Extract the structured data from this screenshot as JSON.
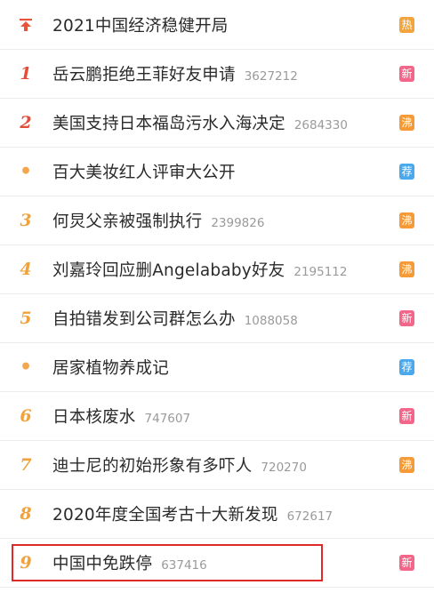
{
  "badge_colors": {
    "热": "#f2a43d",
    "新": "#f3668a",
    "沸": "#f59a36",
    "荐": "#4aa8ed"
  },
  "items": [
    {
      "rank": "",
      "rank_style": "pin",
      "title": "2021中国经济稳健开局",
      "count": "",
      "badge": "热"
    },
    {
      "rank": "1",
      "rank_style": "r1",
      "title": "岳云鹏拒绝王菲好友申请",
      "count": "3627212",
      "badge": "新"
    },
    {
      "rank": "2",
      "rank_style": "r2",
      "title": "美国支持日本福岛污水入海决定",
      "count": "2684330",
      "badge": "沸"
    },
    {
      "rank": "•",
      "rank_style": "dot",
      "title": "百大美妆红人评审大公开",
      "count": "",
      "badge": "荐"
    },
    {
      "rank": "3",
      "rank_style": "rn",
      "title": "何炅父亲被强制执行",
      "count": "2399826",
      "badge": "沸"
    },
    {
      "rank": "4",
      "rank_style": "rn",
      "title": "刘嘉玲回应删Angelababy好友",
      "count": "2195112",
      "badge": "沸"
    },
    {
      "rank": "5",
      "rank_style": "rn",
      "title": "自拍错发到公司群怎么办",
      "count": "1088058",
      "badge": "新"
    },
    {
      "rank": "•",
      "rank_style": "dot",
      "title": "居家植物养成记",
      "count": "",
      "badge": "荐"
    },
    {
      "rank": "6",
      "rank_style": "rn",
      "title": "日本核废水",
      "count": "747607",
      "badge": "新"
    },
    {
      "rank": "7",
      "rank_style": "rn",
      "title": "迪士尼的初始形象有多吓人",
      "count": "720270",
      "badge": "沸"
    },
    {
      "rank": "8",
      "rank_style": "rn",
      "title": "2020年度全国考古十大新发现",
      "count": "672617",
      "badge": ""
    },
    {
      "rank": "9",
      "rank_style": "rn",
      "title": "中国中免跌停",
      "count": "637416",
      "badge": "新"
    }
  ]
}
